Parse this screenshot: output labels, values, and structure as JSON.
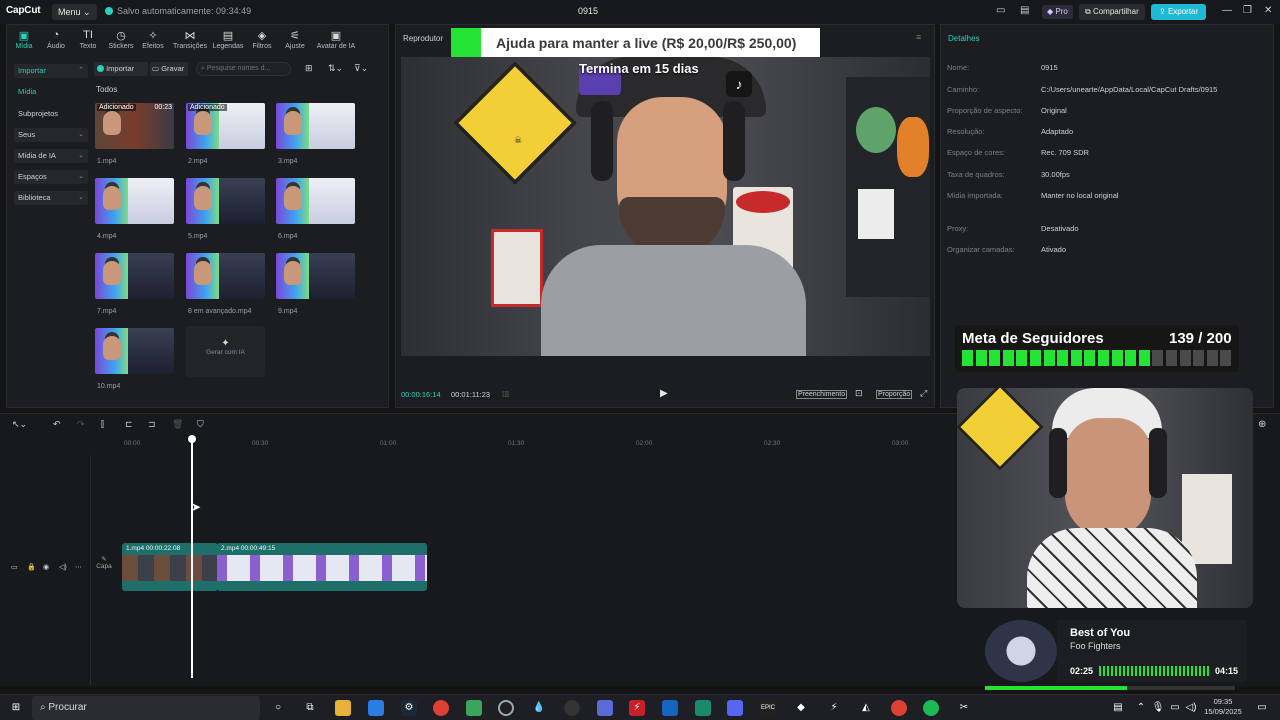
{
  "titlebar": {
    "logo": "CapCut",
    "menu": "Menu",
    "saved": "Salvo automaticamente: 09:34:49",
    "project": "0915",
    "pro": "Pro",
    "share": "Compartilhar",
    "export": "Exportar"
  },
  "toolbar": [
    "Mídia",
    "Áudio",
    "Texto",
    "Stickers",
    "Efeitos",
    "Transições",
    "Legendas",
    "Filtros",
    "Ajuste",
    "Avatar de IA"
  ],
  "sidebar": [
    "Importar",
    "Mídia",
    "Subprojetos",
    "Seus",
    "Mídia de IA",
    "Espaços",
    "Biblioteca"
  ],
  "media_bar": {
    "import": "Importar",
    "record": "Gravar",
    "search_placeholder": "Pesquise nomes d...",
    "section": "Todos"
  },
  "media": [
    {
      "name": "1.mp4",
      "badge": "Adicionado",
      "dur": "00:23"
    },
    {
      "name": "2.mp4",
      "badge": "Adicionado",
      "dur": ""
    },
    {
      "name": "3.mp4",
      "badge": "",
      "dur": ""
    },
    {
      "name": "4.mp4",
      "badge": "",
      "dur": ""
    },
    {
      "name": "5.mp4",
      "badge": "",
      "dur": ""
    },
    {
      "name": "6.mp4",
      "badge": "",
      "dur": ""
    },
    {
      "name": "7.mp4",
      "badge": "",
      "dur": ""
    },
    {
      "name": "8 em avançado.mp4",
      "badge": "",
      "dur": ""
    },
    {
      "name": "9.mp4",
      "badge": "",
      "dur": ""
    },
    {
      "name": "10.mp4",
      "badge": "",
      "dur": ""
    }
  ],
  "generate_ai": "Gerar com IA",
  "player": {
    "title": "Reprodutor",
    "current": "00:00:16:14",
    "total": "00:01:11:23",
    "fill": "Preenchimento",
    "ratio": "Proporção",
    "donation": "Ajuda para manter a live (R$ 20,00/R$ 250,00)",
    "ends": "Termina em 15 dias"
  },
  "details": {
    "title": "Detalhes",
    "rows": [
      {
        "k": "Nome:",
        "v": "0915"
      },
      {
        "k": "Caminho:",
        "v": "C:/Users/unearte/AppData/Local/CapCut Drafts/0915"
      },
      {
        "k": "Proporção de aspecto:",
        "v": "Original"
      },
      {
        "k": "Resolução:",
        "v": "Adaptado"
      },
      {
        "k": "Espaço de cores:",
        "v": "Rec. 709 SDR"
      },
      {
        "k": "Taxa de quadros:",
        "v": "30.00fps"
      },
      {
        "k": "Mídia importada:",
        "v": "Manter no local original"
      },
      {
        "k": "Proxy:",
        "v": "Desativado"
      },
      {
        "k": "Organizar camadas:",
        "v": "Ativado"
      }
    ]
  },
  "timeline": {
    "ticks": [
      "00:00",
      "00:30",
      "01:00",
      "01:30",
      "02:00",
      "02:30",
      "03:00"
    ],
    "cover": "Capa",
    "clip1": "1.mp4   00:00:22:08",
    "clip2": "2.mp4   00:00:49:15"
  },
  "overlay": {
    "goal_title": "Meta de Seguidores",
    "goal_count": "139 / 200",
    "goal_fraction": 0.695,
    "song": "Best of You",
    "artist": "Foo Fighters",
    "elapsed": "02:25",
    "length": "04:15"
  },
  "taskbar": {
    "search": "Procurar",
    "time": "09:35",
    "date": "15/09/2025"
  },
  "colors": {
    "accent": "#2ad1c0",
    "export": "#1fb9d8",
    "goal_bar": "#24e334"
  }
}
